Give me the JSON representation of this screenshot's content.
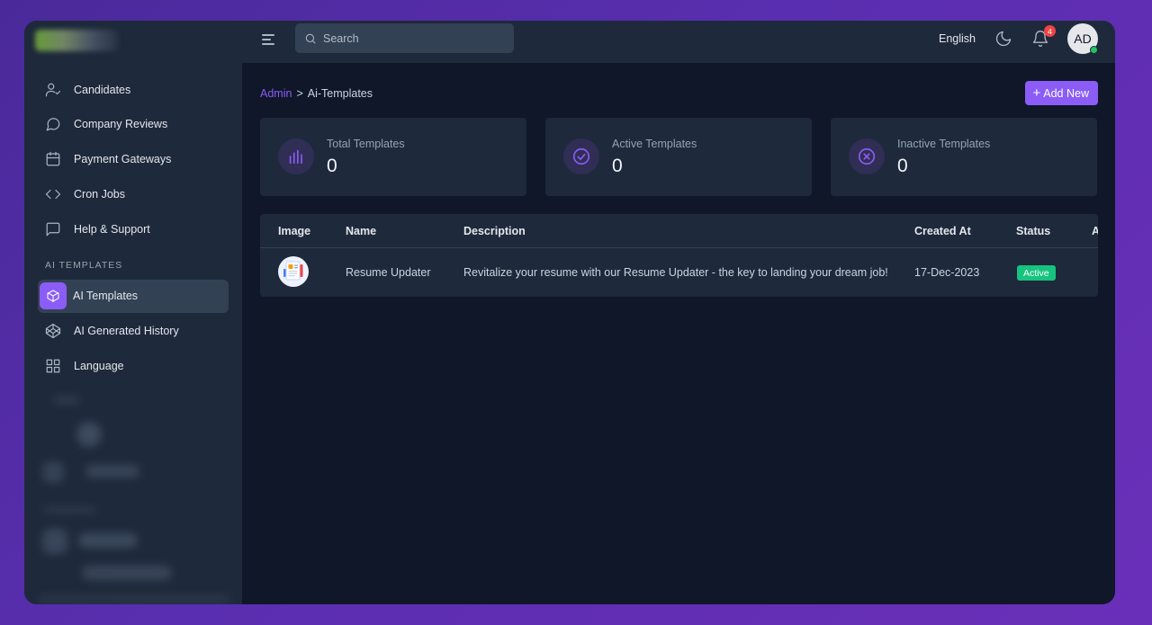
{
  "sidebar": {
    "items": [
      {
        "label": "Candidates",
        "icon": "user-check-icon"
      },
      {
        "label": "Company Reviews",
        "icon": "message-circle-icon"
      },
      {
        "label": "Payment Gateways",
        "icon": "calendar-icon"
      },
      {
        "label": "Cron Jobs",
        "icon": "code-icon"
      },
      {
        "label": "Help & Support",
        "icon": "message-square-icon"
      }
    ],
    "section_label": "AI TEMPLATES",
    "ai_items": [
      {
        "label": "AI Templates",
        "icon": "box-icon",
        "active": true
      },
      {
        "label": "AI Generated History",
        "icon": "codepen-icon"
      },
      {
        "label": "Language",
        "icon": "grid-icon"
      }
    ]
  },
  "topbar": {
    "search_placeholder": "Search",
    "language": "English",
    "notification_count": "4",
    "avatar_initials": "AD"
  },
  "breadcrumb": {
    "root": "Admin",
    "separator": ">",
    "current": "Ai-Templates"
  },
  "add_button": "Add New",
  "stats": [
    {
      "title": "Total Templates",
      "value": "0",
      "icon": "bar-chart-icon"
    },
    {
      "title": "Active Templates",
      "value": "0",
      "icon": "check-circle-icon"
    },
    {
      "title": "Inactive Templates",
      "value": "0",
      "icon": "x-circle-icon"
    }
  ],
  "table": {
    "columns": [
      "Image",
      "Name",
      "Description",
      "Created At",
      "Status",
      "A"
    ],
    "rows": [
      {
        "name": "Resume Updater",
        "description": "Revitalize your resume with our Resume Updater - the key to landing your dream job!",
        "created_at": "17-Dec-2023",
        "status": "Active"
      }
    ]
  },
  "colors": {
    "accent": "#8b5cf6",
    "success": "#16c47f",
    "danger": "#ef4444",
    "surface": "#1e293b",
    "background": "#0f1729"
  }
}
